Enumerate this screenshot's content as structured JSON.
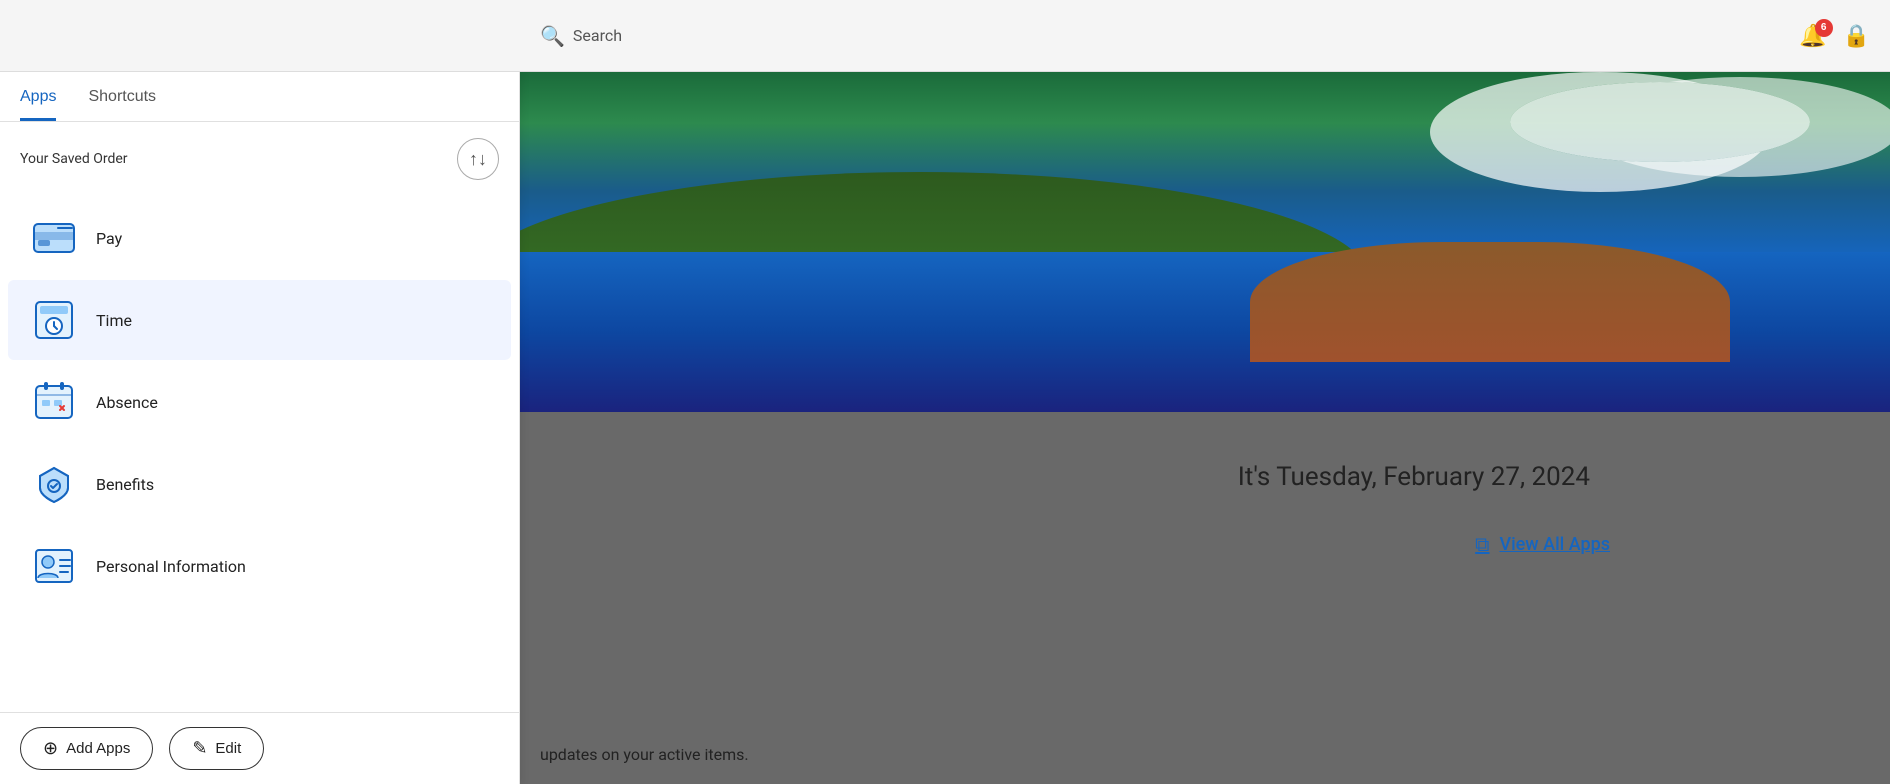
{
  "header": {
    "search_placeholder": "Search",
    "search_text": "Search",
    "notification_count": "6"
  },
  "left_panel": {
    "tabs": [
      {
        "id": "apps",
        "label": "Apps",
        "active": true
      },
      {
        "id": "shortcuts",
        "label": "Shortcuts",
        "active": false
      }
    ],
    "saved_order_label": "Your Saved Order",
    "reorder_button_label": "↑↓",
    "apps": [
      {
        "id": "pay",
        "label": "Pay",
        "icon": "pay-icon"
      },
      {
        "id": "time",
        "label": "Time",
        "icon": "time-icon",
        "hovered": true
      },
      {
        "id": "absence",
        "label": "Absence",
        "icon": "absence-icon"
      },
      {
        "id": "benefits",
        "label": "Benefits",
        "icon": "benefits-icon"
      },
      {
        "id": "personal-information",
        "label": "Personal Information",
        "icon": "personal-info-icon"
      }
    ],
    "bottom_actions": [
      {
        "id": "add-apps",
        "label": "Add Apps",
        "icon": "+"
      },
      {
        "id": "edit",
        "label": "Edit",
        "icon": "✎"
      }
    ]
  },
  "main": {
    "date_text": "It's Tuesday, February 27, 2024",
    "view_all_apps_label": "View All Apps",
    "updates_text": "updates on your active items."
  }
}
